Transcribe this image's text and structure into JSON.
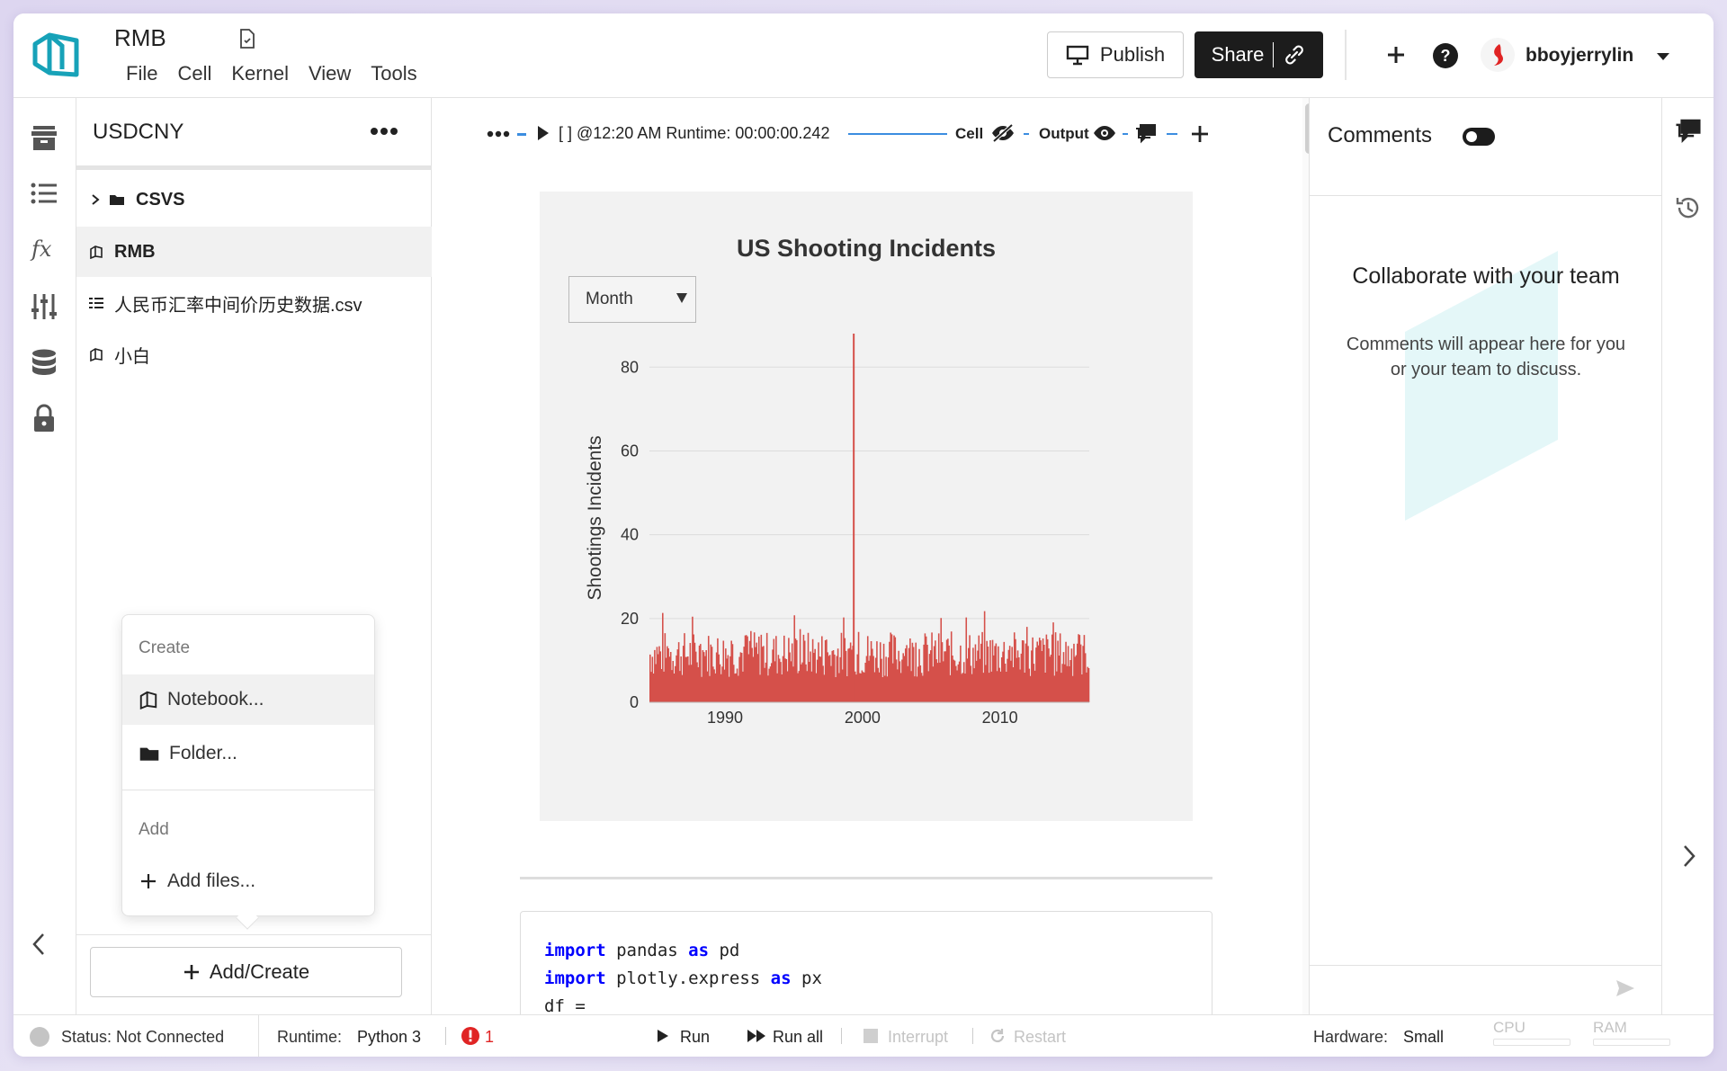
{
  "app": {
    "title": "RMB",
    "menu": [
      "File",
      "Cell",
      "Kernel",
      "View",
      "Tools"
    ]
  },
  "header": {
    "publish_label": "Publish",
    "share_label": "Share",
    "username": "bboyjerrylin"
  },
  "sidebar": {
    "project_title": "USDCNY",
    "files": [
      {
        "name": "CSVS",
        "type": "folder"
      },
      {
        "name": "RMB",
        "type": "notebook",
        "active": true
      },
      {
        "name": "人民币汇率中间价历史数据.csv",
        "type": "csv"
      },
      {
        "name": "小白",
        "type": "notebook"
      }
    ],
    "add_create_label": "Add/Create"
  },
  "create_menu": {
    "create_header": "Create",
    "notebook_label": "Notebook...",
    "folder_label": "Folder...",
    "add_header": "Add",
    "add_files_label": "Add files..."
  },
  "cell_toolbar": {
    "exec_info": "[ ] @12:20 AM Runtime: 00:00:00.242",
    "cell_label": "Cell",
    "output_label": "Output"
  },
  "chart_controls": {
    "dropdown_value": "Month"
  },
  "chart_data": {
    "type": "bar",
    "title": "US Shooting Incidents",
    "xlabel": "",
    "ylabel": "Shootings Incidents",
    "xlim": [
      1984.5,
      2016.5
    ],
    "ylim": [
      0,
      88
    ],
    "yticks": [
      0,
      20,
      40,
      60,
      80
    ],
    "xticks": [
      1990,
      2000,
      2010
    ],
    "color": "#d5504a",
    "baseline": "monthly counts mostly between 5 and 20",
    "spike": {
      "x": 1999.3,
      "y": 88
    }
  },
  "code": {
    "lines": [
      {
        "parts": [
          {
            "t": "import",
            "k": "kw"
          },
          {
            "t": " pandas ",
            "k": ""
          },
          {
            "t": "as",
            "k": "kw"
          },
          {
            "t": " pd",
            "k": ""
          }
        ]
      },
      {
        "parts": [
          {
            "t": "import",
            "k": "kw"
          },
          {
            "t": " plotly.express ",
            "k": ""
          },
          {
            "t": "as",
            "k": "kw"
          },
          {
            "t": " px",
            "k": ""
          }
        ]
      },
      {
        "parts": [
          {
            "t": "df =",
            "k": ""
          }
        ]
      }
    ]
  },
  "comments": {
    "title": "Comments",
    "heading": "Collaborate with your team",
    "body": "Comments will appear here for you or your team to discuss."
  },
  "status": {
    "status_text": "Status: Not Connected",
    "runtime_label": "Runtime:",
    "runtime_value": "Python 3",
    "error_count": "1",
    "run_label": "Run",
    "run_all_label": "Run all",
    "interrupt_label": "Interrupt",
    "restart_label": "Restart",
    "hardware_label": "Hardware:",
    "hardware_value": "Small",
    "cpu_label": "CPU",
    "ram_label": "RAM"
  },
  "colors": {
    "accent": "#17a2b8",
    "bar": "#d5504a",
    "link_blue": "#3b8de0",
    "error": "#e02424"
  }
}
